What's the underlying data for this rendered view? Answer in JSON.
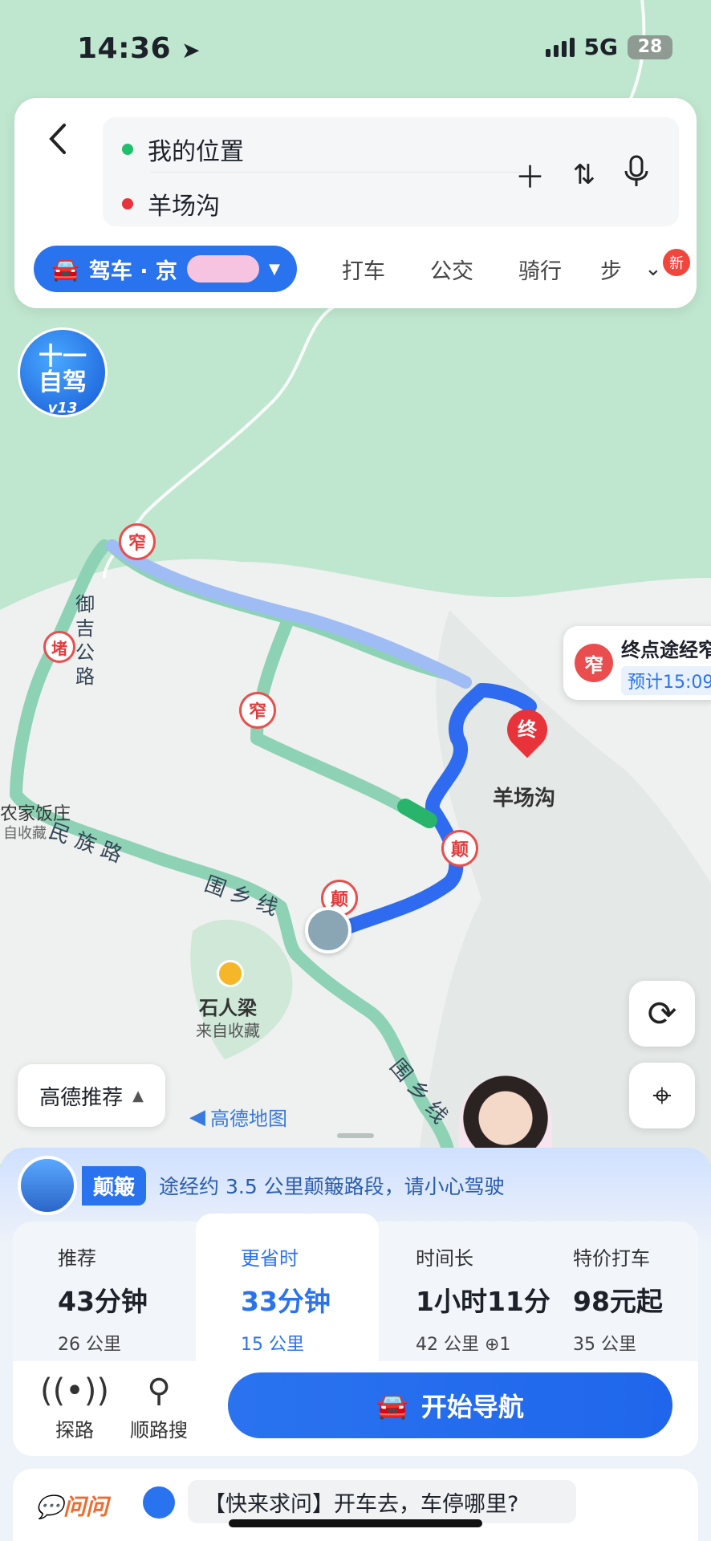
{
  "status_bar": {
    "time": "14:36",
    "network": "5G",
    "battery": "28"
  },
  "search": {
    "origin": "我的位置",
    "destination": "羊场沟",
    "origin_color": "#1fbf6b",
    "destination_color": "#e8333b"
  },
  "modes": {
    "active": "驾车 · 京",
    "tabs": [
      "打车",
      "公交",
      "骑行",
      "步"
    ],
    "badge": "新"
  },
  "self_drive_badge": {
    "line1": "十一",
    "line2": "自驾",
    "line3": "v13"
  },
  "map": {
    "labels": {
      "road_yuxin": "御\n吉\n公\n路",
      "minzu_road": "民 族 路",
      "weixiang_1": "围 乡 线",
      "weixiang_2": "围 乡 线",
      "restaurant": "农家饭庄",
      "restaurant_sub": "自收藏",
      "shirenliang": "石人梁",
      "shirenliang_sub": "来自收藏",
      "destination": "羊场沟"
    },
    "pins": {
      "narrow": "窄",
      "jam": "堵",
      "bumpy": "颠",
      "end": "终"
    },
    "dest_bubble": {
      "icon": "窄",
      "title": "终点途经窄",
      "eta": "预计15:09"
    },
    "recommend_btn": "高德推荐",
    "logo": "高德地图",
    "route_color": "#2f6bf0",
    "alt_route_color": "#8ed2b6"
  },
  "alert": {
    "tag": "颠簸",
    "text": "途经约 3.5 公里颠簸路段，请小心驾驶"
  },
  "routes": [
    {
      "label": "推荐",
      "duration": "43分钟",
      "distance": "26 公里"
    },
    {
      "label": "更省时",
      "duration": "33分钟",
      "distance": "15 公里"
    },
    {
      "label": "时间长",
      "duration": "1小时11分",
      "distance": "42 公里  ⊕1"
    },
    {
      "label": "特价打车",
      "duration": "98元起",
      "distance": "35 公里"
    }
  ],
  "tools": {
    "explore": "探路",
    "along_search": "顺路搜"
  },
  "start_nav": "开始导航",
  "ask": {
    "brand": "问问",
    "question": "【快来求问】开车去，车停哪里?"
  }
}
